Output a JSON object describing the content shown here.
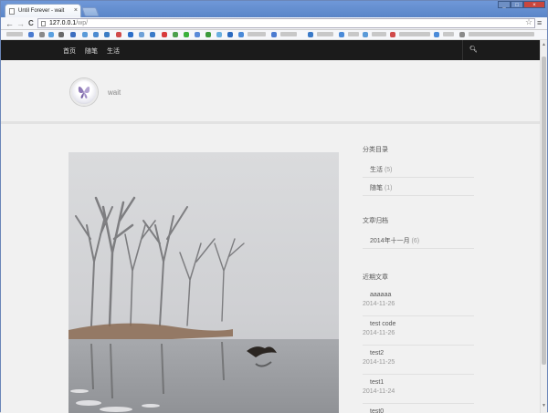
{
  "browser": {
    "tab_title": "Until Forever - wait",
    "tab_close": "×",
    "window_controls": {
      "minimize": "_",
      "maximize": "□",
      "close": "×"
    },
    "nav": {
      "back": "←",
      "forward": "→",
      "reload": "C"
    },
    "url_host": "127.0.0.1",
    "url_path": "/wp/",
    "star": "☆",
    "menu": "≡"
  },
  "site": {
    "nav": [
      "首页",
      "随笔",
      "生活"
    ],
    "search_icon": "🔍︎",
    "title": "wait"
  },
  "sidebar": {
    "categories": {
      "title": "分类目录",
      "items": [
        {
          "name": "生活",
          "count": "(5)"
        },
        {
          "name": "随笔",
          "count": "(1)"
        }
      ]
    },
    "archives": {
      "title": "文章归档",
      "items": [
        {
          "name": "2014年十一月",
          "count": "(6)"
        }
      ]
    },
    "recent": {
      "title": "近期文章",
      "items": [
        {
          "title": "aaaaaa",
          "date": "2014-11-26"
        },
        {
          "title": "test code",
          "date": "2014-11-26"
        },
        {
          "title": "test2",
          "date": "2014-11-25"
        },
        {
          "title": "test1",
          "date": "2014-11-24"
        },
        {
          "title": "test0",
          "date": ""
        }
      ]
    }
  },
  "colors": {
    "nav_bg": "#1b1b1b",
    "page_bg": "#f1f1f1",
    "titlebar": "#5a85c8"
  }
}
